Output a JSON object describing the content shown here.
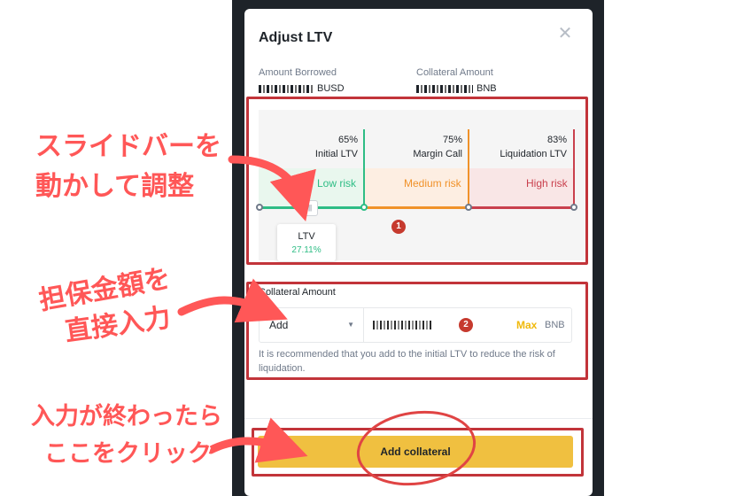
{
  "modal": {
    "title": "Adjust LTV",
    "close_glyph": "✕"
  },
  "borrowed": {
    "label": "Amount Borrowed",
    "unit": "BUSD"
  },
  "collateral_info": {
    "label": "Collateral Amount",
    "unit": "BNB"
  },
  "ltv": {
    "current_label": "LTV",
    "current_value": "27.11%",
    "current_fraction": 0.2711,
    "thresholds": [
      {
        "percent": "65%",
        "name": "Initial LTV",
        "color": "#2ebd85"
      },
      {
        "percent": "75%",
        "name": "Margin Call",
        "color": "#f0922a"
      },
      {
        "percent": "83%",
        "name": "Liquidation LTV",
        "color": "#c9404d"
      }
    ],
    "zones": [
      {
        "label": "Low risk",
        "color": "#2ebd85"
      },
      {
        "label": "Medium risk",
        "color": "#f0922a"
      },
      {
        "label": "High risk",
        "color": "#c9404d"
      }
    ],
    "handle_glyph": "|||"
  },
  "collateral_form": {
    "title": "Collateral Amount",
    "mode": "Add",
    "caret_glyph": "▼",
    "max_label": "Max",
    "unit": "BNB",
    "hint": "It is recommended that you add to the initial LTV to reduce the risk of liquidation."
  },
  "submit": {
    "label": "Add collateral"
  },
  "annotations": {
    "step1": "1",
    "step2": "2",
    "note1_line1": "スライドバーを",
    "note1_line2": "動かして調整",
    "note2_line1": "担保金額を",
    "note2_line2": "直接入力",
    "note3_line1": "入力が終わったら",
    "note3_line2": "ここをクリック",
    "color": "#ff5757"
  }
}
